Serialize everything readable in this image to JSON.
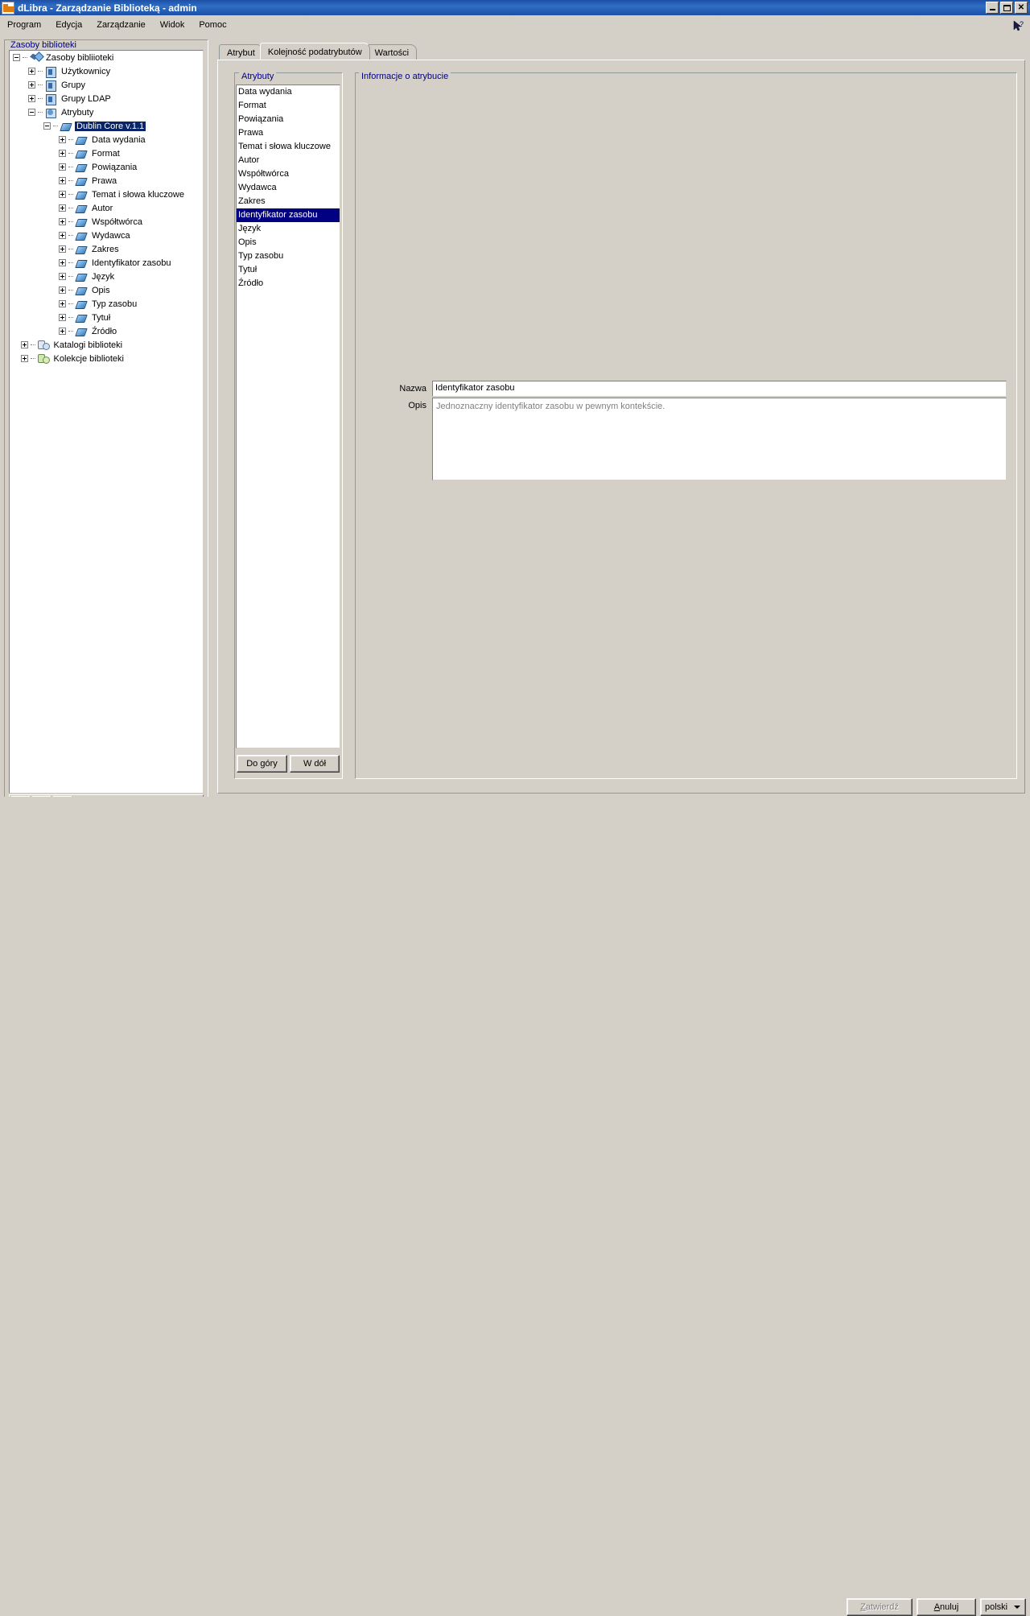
{
  "window": {
    "title": "dLibra - Zarządzanie Biblioteką - admin",
    "icon": "app-icon",
    "minimize": "minimize-icon",
    "maximize": "maximize-icon",
    "close": "close-icon"
  },
  "menu": {
    "items": [
      {
        "label": "Program"
      },
      {
        "label": "Edycja"
      },
      {
        "label": "Zarządzanie"
      },
      {
        "label": "Widok"
      },
      {
        "label": "Pomoc"
      }
    ],
    "help_cursor_icon": "help-arrow-icon"
  },
  "left_panel": {
    "legend": "Zasoby biblioteki",
    "tree": [
      {
        "label": "Zasoby bibliioteki",
        "depth": 0,
        "expander": "minus",
        "icon": "library-resources-icon",
        "selected": false
      },
      {
        "label": "Użytkownicy",
        "depth": 1,
        "expander": "plus",
        "icon": "users-icon",
        "selected": false
      },
      {
        "label": "Grupy",
        "depth": 1,
        "expander": "plus",
        "icon": "groups-icon",
        "selected": false
      },
      {
        "label": "Grupy LDAP",
        "depth": 1,
        "expander": "plus",
        "icon": "groups-ldap-icon",
        "selected": false
      },
      {
        "label": "Atrybuty",
        "depth": 1,
        "expander": "minus",
        "icon": "attributes-folder-icon",
        "selected": false
      },
      {
        "label": "Dublin Core v.1.1",
        "depth": 2,
        "expander": "minus",
        "icon": "attribute-icon",
        "selected": true
      },
      {
        "label": "Data wydania",
        "depth": 3,
        "expander": "plus",
        "icon": "attribute-icon",
        "selected": false
      },
      {
        "label": "Format",
        "depth": 3,
        "expander": "plus",
        "icon": "attribute-icon",
        "selected": false
      },
      {
        "label": "Powiązania",
        "depth": 3,
        "expander": "plus",
        "icon": "attribute-icon",
        "selected": false
      },
      {
        "label": "Prawa",
        "depth": 3,
        "expander": "plus",
        "icon": "attribute-icon",
        "selected": false
      },
      {
        "label": "Temat i słowa kluczowe",
        "depth": 3,
        "expander": "plus",
        "icon": "attribute-icon",
        "selected": false
      },
      {
        "label": "Autor",
        "depth": 3,
        "expander": "plus",
        "icon": "attribute-icon",
        "selected": false
      },
      {
        "label": "Współtwórca",
        "depth": 3,
        "expander": "plus",
        "icon": "attribute-icon",
        "selected": false
      },
      {
        "label": "Wydawca",
        "depth": 3,
        "expander": "plus",
        "icon": "attribute-icon",
        "selected": false
      },
      {
        "label": "Zakres",
        "depth": 3,
        "expander": "plus",
        "icon": "attribute-icon",
        "selected": false
      },
      {
        "label": "Identyfikator zasobu",
        "depth": 3,
        "expander": "plus",
        "icon": "attribute-icon",
        "selected": false
      },
      {
        "label": "Język",
        "depth": 3,
        "expander": "plus",
        "icon": "attribute-icon",
        "selected": false
      },
      {
        "label": "Opis",
        "depth": 3,
        "expander": "plus",
        "icon": "attribute-icon",
        "selected": false
      },
      {
        "label": "Typ zasobu",
        "depth": 3,
        "expander": "plus",
        "icon": "attribute-icon",
        "selected": false
      },
      {
        "label": "Tytuł",
        "depth": 3,
        "expander": "plus",
        "icon": "attribute-icon",
        "selected": false
      },
      {
        "label": "Źródło",
        "depth": 3,
        "expander": "plus",
        "icon": "attribute-icon",
        "selected": false
      },
      {
        "label": "Katalogi biblioteki",
        "depth": 0.5,
        "expander": "plus",
        "icon": "catalogs-icon",
        "selected": false
      },
      {
        "label": "Kolekcje biblioteki",
        "depth": 0.5,
        "expander": "plus",
        "icon": "collections-icon",
        "selected": false
      }
    ],
    "toolbar": [
      {
        "icon": "add-user-icon"
      },
      {
        "icon": "user-icon"
      },
      {
        "icon": "edit-user-icon"
      }
    ]
  },
  "tabs": [
    {
      "label": "Atrybut",
      "active": false
    },
    {
      "label": "Kolejność podatrybutów",
      "active": true
    },
    {
      "label": "Wartości",
      "active": false
    }
  ],
  "attributes_panel": {
    "legend": "Atrybuty",
    "items": [
      {
        "label": "Data wydania",
        "selected": false
      },
      {
        "label": "Format",
        "selected": false
      },
      {
        "label": "Powiązania",
        "selected": false
      },
      {
        "label": "Prawa",
        "selected": false
      },
      {
        "label": "Temat i słowa kluczowe",
        "selected": false
      },
      {
        "label": "Autor",
        "selected": false
      },
      {
        "label": "Współtwórca",
        "selected": false
      },
      {
        "label": "Wydawca",
        "selected": false
      },
      {
        "label": "Zakres",
        "selected": false
      },
      {
        "label": "Identyfikator zasobu",
        "selected": true
      },
      {
        "label": "Język",
        "selected": false
      },
      {
        "label": "Opis",
        "selected": false
      },
      {
        "label": "Typ zasobu",
        "selected": false
      },
      {
        "label": "Tytuł",
        "selected": false
      },
      {
        "label": "Źródło",
        "selected": false
      }
    ],
    "move_up": "Do góry",
    "move_down": "W dół"
  },
  "info_panel": {
    "legend": "Informacje o atrybucie",
    "name_label": "Nazwa",
    "name_value": "Identyfikator zasobu",
    "description_label": "Opis",
    "description_value": "Jednoznaczny identyfikator zasobu w pewnym kontekście."
  },
  "bottom_bar": {
    "confirm_label": "Zatwierdź",
    "confirm_accel": "Z",
    "cancel_label": "Anuluj",
    "cancel_accel": "A",
    "language_value": "polski"
  },
  "colors": {
    "titlebar": "#1d4fa5",
    "window_bg": "#d4d0c8",
    "selection": "#000080",
    "legend_text": "#000080",
    "disabled_text": "#808080"
  }
}
